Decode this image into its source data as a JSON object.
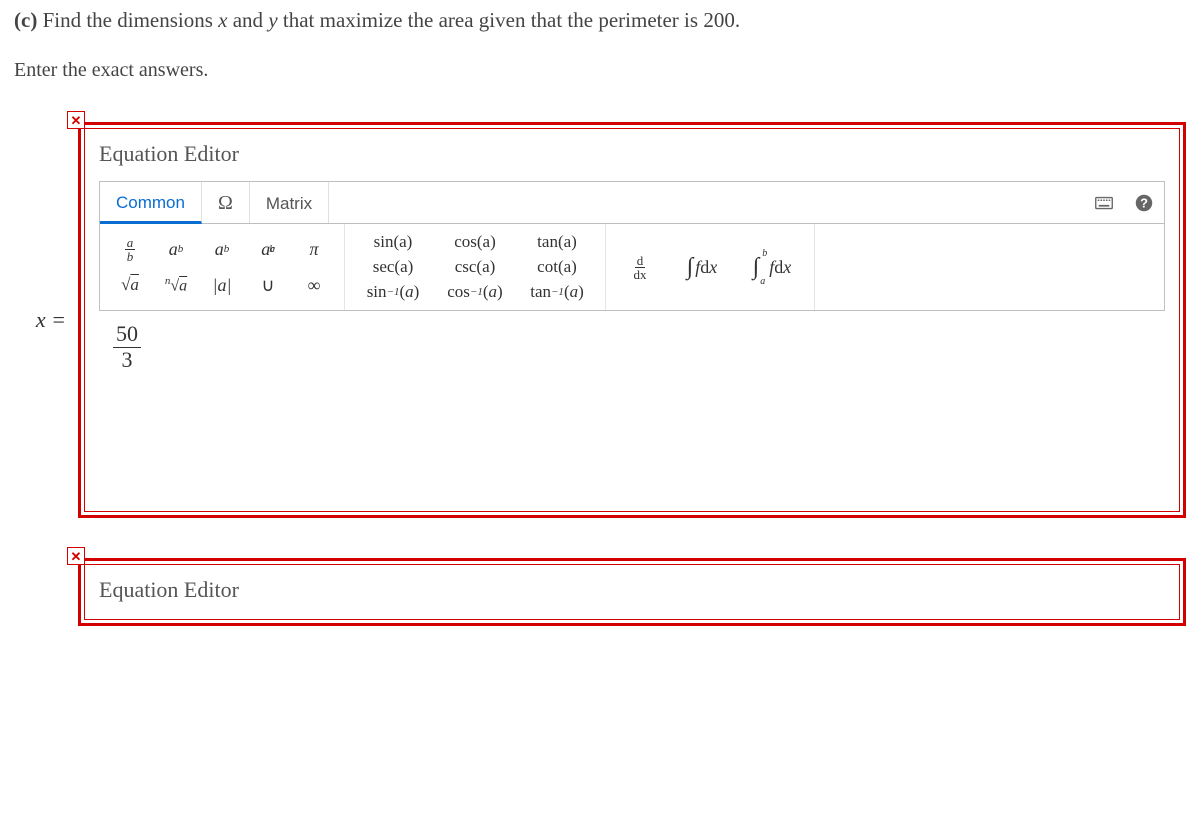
{
  "question": {
    "part_label": "(c)",
    "text_before_x": " Find the dimensions ",
    "var_x": "x",
    "text_mid": " and ",
    "var_y": "y",
    "text_after": " that maximize the area given that the perimeter is ",
    "perimeter_value": "200",
    "period": "."
  },
  "instruction": "Enter the exact answers.",
  "lhs_x": "x =",
  "editor": {
    "title": "Equation Editor",
    "tabs": {
      "common": "Common",
      "omega": "Ω",
      "matrix": "Matrix"
    },
    "buttons": {
      "frac": {
        "n": "a",
        "d": "b"
      },
      "power": {
        "base": "a",
        "exp": "b"
      },
      "sub": {
        "base": "a",
        "s": "b"
      },
      "subsup": {
        "base": "a",
        "s": "b",
        "e": "c"
      },
      "pi": "π",
      "sqrt": "√a",
      "nroot": "ⁿ√a",
      "abs": "|a|",
      "union": "∪",
      "inf": "∞",
      "sin": "sin(a)",
      "cos": "cos(a)",
      "tan": "tan(a)",
      "sec": "sec(a)",
      "csc": "csc(a)",
      "cot": "cot(a)",
      "asin": "sin⁻¹(a)",
      "acos": "cos⁻¹(a)",
      "atan": "tan⁻¹(a)",
      "ddx": {
        "n": "d",
        "d": "dx"
      },
      "int": "∫ f dx",
      "defint_low": "a",
      "defint_high": "b",
      "defint_body": "∫  f dx"
    },
    "input_value": {
      "numer": "50",
      "denom": "3"
    }
  }
}
